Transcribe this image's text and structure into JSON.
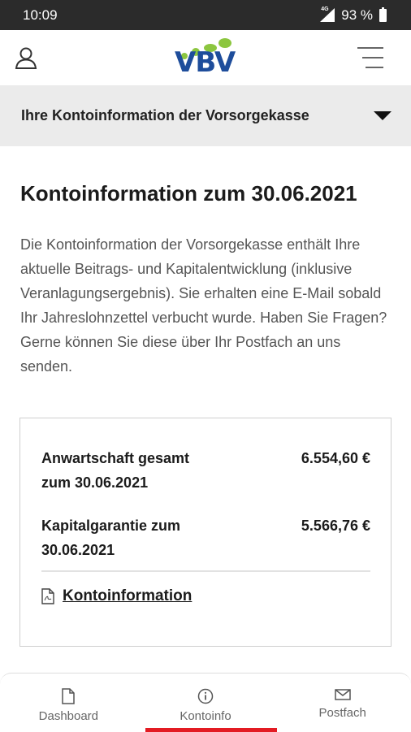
{
  "status": {
    "time": "10:09",
    "network": "4G",
    "battery": "93 %"
  },
  "header": {
    "logo_text": "VBV"
  },
  "selector": {
    "label": "Ihre Kontoinformation der Vorsorgekasse"
  },
  "main": {
    "title": "Kontoinformation zum 30.06.2021",
    "intro": "Die Kontoinformation der Vorsorgekasse enthält Ihre aktuelle Beitrags- und Kapitalentwicklung (inklusive Veranlagungsergebnis). Sie erhalten eine E-Mail sobald Ihr Jahreslohnzettel verbucht wurde. Haben Sie Fragen? Gerne können Sie diese über Ihr Postfach an uns senden."
  },
  "card": {
    "rows": [
      {
        "label": "Anwartschaft gesamt zum 30.06.2021",
        "value": "6.554,60 €"
      },
      {
        "label": "Kapitalgarantie zum 30.06.2021",
        "value": "5.566,76 €"
      }
    ],
    "link_label": "Kontoinformation"
  },
  "bottomnav": {
    "items": [
      {
        "label": "Dashboard",
        "icon": "document-icon"
      },
      {
        "label": "Kontoinfo",
        "icon": "info-icon",
        "active": true
      },
      {
        "label": "Postfach",
        "icon": "envelope-icon"
      }
    ]
  },
  "colors": {
    "brand_blue": "#1e4d9b",
    "brand_green": "#8cc63f",
    "active_red": "#e31b23"
  }
}
